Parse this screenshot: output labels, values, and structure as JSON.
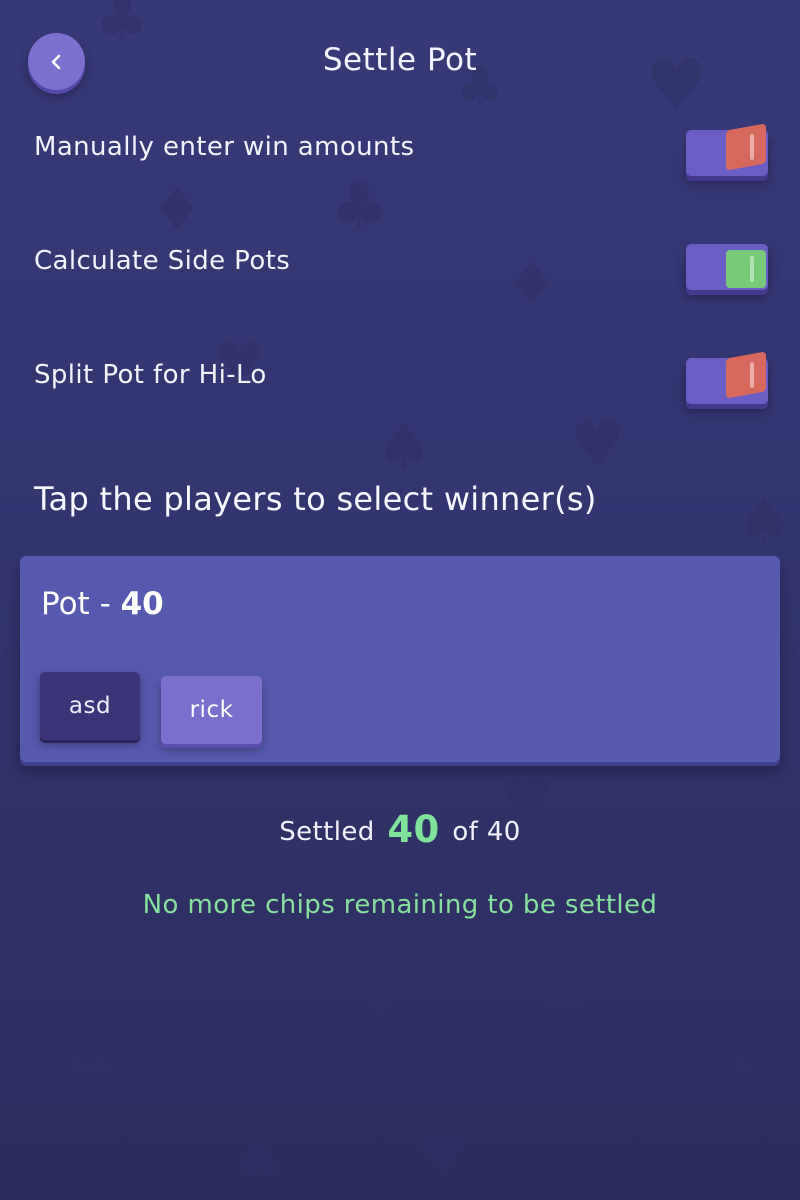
{
  "header": {
    "title": "Settle Pot",
    "back_icon": "chevron-left-icon"
  },
  "toggles": [
    {
      "label": "Manually enter win amounts",
      "state": "off",
      "color": "#d8685e"
    },
    {
      "label": "Calculate Side Pots",
      "state": "on",
      "color": "#78c97a"
    },
    {
      "label": "Split Pot for Hi-Lo",
      "state": "off",
      "color": "#d8685e"
    }
  ],
  "instruction": "Tap the players to select winner(s)",
  "pot": {
    "label": "Pot - ",
    "amount": "40",
    "players": [
      {
        "name": "asd",
        "selected": true
      },
      {
        "name": "rick",
        "selected": false
      }
    ]
  },
  "summary": {
    "settled_prefix": "Settled",
    "settled_amount": "40",
    "settled_suffix": "of 40",
    "status": "No more chips remaining to be settled"
  },
  "colors": {
    "background": "#383a78",
    "accent": "#7b6fd0",
    "pot_card": "#5659ad",
    "success": "#86e09f"
  }
}
